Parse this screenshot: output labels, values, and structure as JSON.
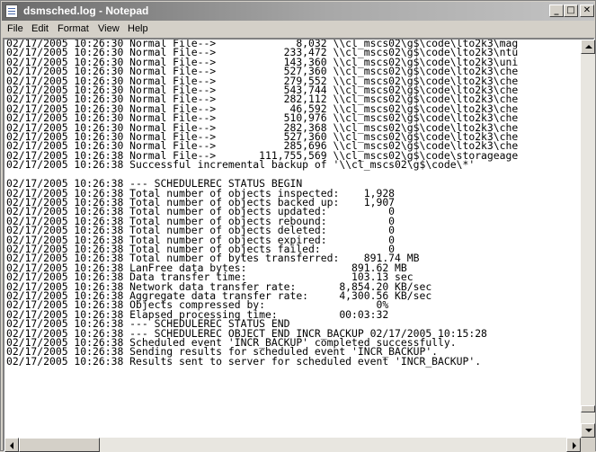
{
  "window": {
    "title": "dsmsched.log - Notepad",
    "minimize_glyph": "_",
    "maximize_glyph": "□",
    "close_glyph": "✕"
  },
  "menu": [
    "File",
    "Edit",
    "Format",
    "View",
    "Help"
  ],
  "icons": {
    "app": "notepad-icon",
    "scroll_up": "arrow-up-icon",
    "scroll_down": "arrow-down-icon",
    "scroll_left": "arrow-left-icon",
    "scroll_right": "arrow-right-icon"
  },
  "document": {
    "lines": [
      "02/17/2005 10:26:30 Normal File-->             8,032 \\\\cl_mscs02\\g$\\code\\lto2k3\\mag",
      "02/17/2005 10:26:30 Normal File-->           233,472 \\\\cl_mscs02\\g$\\code\\lto2k3\\ntu",
      "02/17/2005 10:26:30 Normal File-->           143,360 \\\\cl_mscs02\\g$\\code\\lto2k3\\uni",
      "02/17/2005 10:26:30 Normal File-->           527,360 \\\\cl_mscs02\\g$\\code\\lto2k3\\che",
      "02/17/2005 10:26:30 Normal File-->           279,552 \\\\cl_mscs02\\g$\\code\\lto2k3\\che",
      "02/17/2005 10:26:30 Normal File-->           543,744 \\\\cl_mscs02\\g$\\code\\lto2k3\\che",
      "02/17/2005 10:26:30 Normal File-->           282,112 \\\\cl_mscs02\\g$\\code\\lto2k3\\che",
      "02/17/2005 10:26:30 Normal File-->            46,592 \\\\cl_mscs02\\g$\\code\\lto2k3\\che",
      "02/17/2005 10:26:30 Normal File-->           510,976 \\\\cl_mscs02\\g$\\code\\lto2k3\\che",
      "02/17/2005 10:26:30 Normal File-->           282,368 \\\\cl_mscs02\\g$\\code\\lto2k3\\che",
      "02/17/2005 10:26:30 Normal File-->           527,360 \\\\cl_mscs02\\g$\\code\\lto2k3\\che",
      "02/17/2005 10:26:30 Normal File-->           285,696 \\\\cl_mscs02\\g$\\code\\lto2k3\\che",
      "02/17/2005 10:26:38 Normal File-->       111,755,569 \\\\cl_mscs02\\g$\\code\\storageage",
      "02/17/2005 10:26:38 Successful incremental backup of '\\\\cl_mscs02\\g$\\code\\*'",
      "",
      "02/17/2005 10:26:38 --- SCHEDULEREC STATUS BEGIN",
      "02/17/2005 10:26:38 Total number of objects inspected:    1,928",
      "02/17/2005 10:26:38 Total number of objects backed up:    1,907",
      "02/17/2005 10:26:38 Total number of objects updated:          0",
      "02/17/2005 10:26:38 Total number of objects rebound:          0",
      "02/17/2005 10:26:38 Total number of objects deleted:          0",
      "02/17/2005 10:26:38 Total number of objects expired:          0",
      "02/17/2005 10:26:38 Total number of objects failed:           0",
      "02/17/2005 10:26:38 Total number of bytes transferred:    891.74 MB",
      "02/17/2005 10:26:38 LanFree data bytes:                 891.62 MB",
      "02/17/2005 10:26:38 Data transfer time:                 103.13 sec",
      "02/17/2005 10:26:38 Network data transfer rate:       8,854.20 KB/sec",
      "02/17/2005 10:26:38 Aggregate data transfer rate:     4,300.56 KB/sec",
      "02/17/2005 10:26:38 Objects compressed by:                  0%",
      "02/17/2005 10:26:38 Elapsed processing time:          00:03:32",
      "02/17/2005 10:26:38 --- SCHEDULEREC STATUS END",
      "02/17/2005 10:26:38 --- SCHEDULEREC OBJECT END INCR_BACKUP 02/17/2005 10:15:28",
      "02/17/2005 10:26:38 Scheduled event 'INCR_BACKUP' completed successfully.",
      "02/17/2005 10:26:38 Sending results for scheduled event 'INCR_BACKUP'.",
      "02/17/2005 10:26:38 Results sent to server for scheduled event 'INCR_BACKUP'."
    ]
  },
  "scroll": {
    "vertical_position": 0.97,
    "horizontal_position": 0.0
  }
}
